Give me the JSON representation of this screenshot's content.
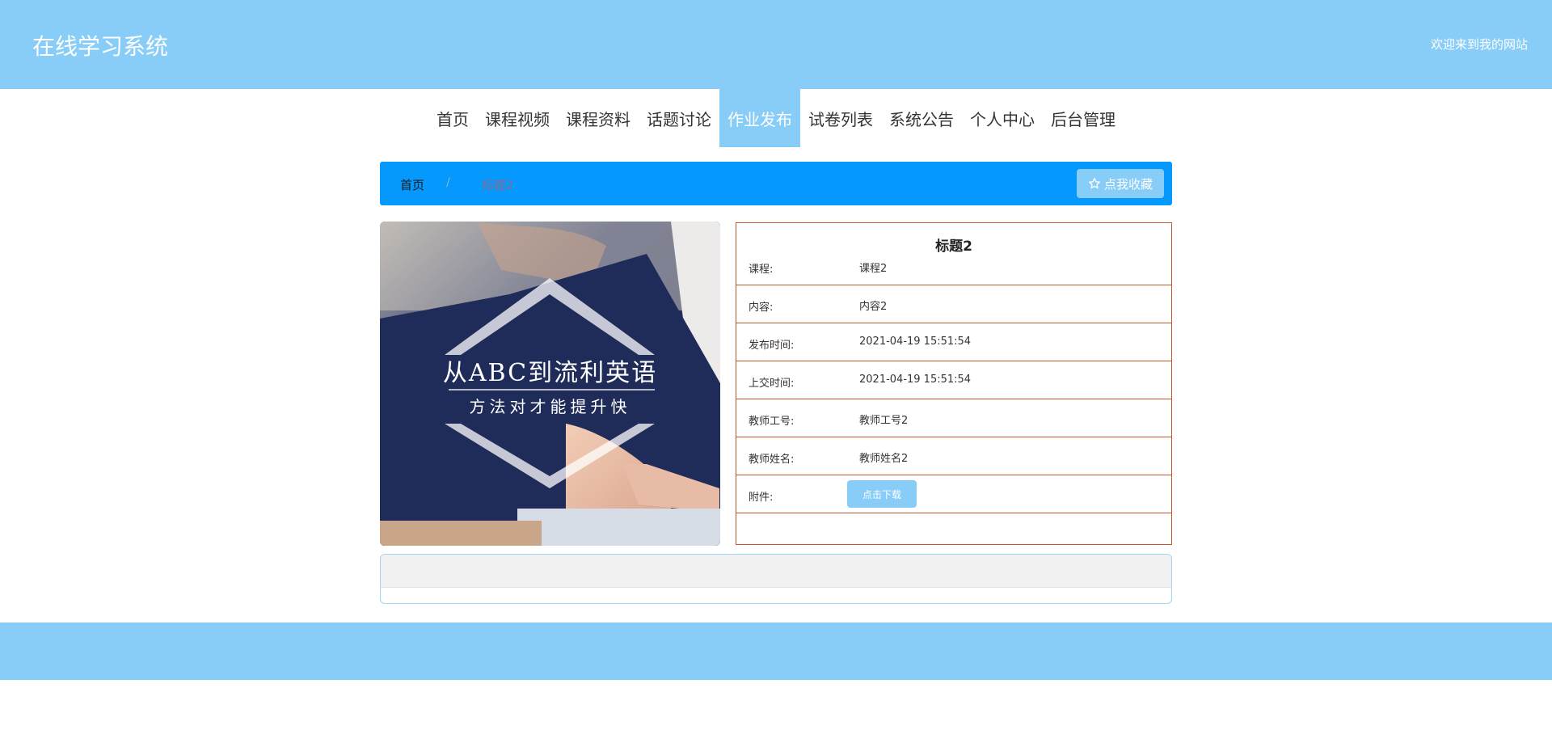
{
  "header": {
    "site_title": "在线学习系统",
    "welcome": "欢迎来到我的网站"
  },
  "nav": {
    "items": [
      {
        "label": "首页"
      },
      {
        "label": "课程视频"
      },
      {
        "label": "课程资料"
      },
      {
        "label": "话题讨论"
      },
      {
        "label": "作业发布"
      },
      {
        "label": "试卷列表"
      },
      {
        "label": "系统公告"
      },
      {
        "label": "个人中心"
      },
      {
        "label": "后台管理"
      }
    ],
    "active_index": 4
  },
  "breadcrumb": {
    "home": "首页",
    "separator": "/",
    "current": "标题2",
    "favorite_label": "点我收藏",
    "favorite_icon": "star-outline-icon"
  },
  "banner_image": {
    "line1": "从ABC到流利英语",
    "line2": "方法对才能提升快"
  },
  "detail": {
    "title": "标题2",
    "rows": [
      {
        "label": "课程:",
        "value": "课程2"
      },
      {
        "label": "内容:",
        "value": "内容2"
      },
      {
        "label": "发布时间:",
        "value": "2021-04-19 15:51:54"
      },
      {
        "label": "上交时间:",
        "value": "2021-04-19 15:51:54"
      },
      {
        "label": "教师工号:",
        "value": "教师工号2"
      },
      {
        "label": "教师姓名:",
        "value": "教师姓名2"
      }
    ],
    "attachment": {
      "label": "附件:",
      "button_label": "点击下载"
    }
  },
  "colors": {
    "header_bg": "#87cdf8",
    "breadcrumb_bg": "#0599fd",
    "table_border": "#c0582f"
  }
}
